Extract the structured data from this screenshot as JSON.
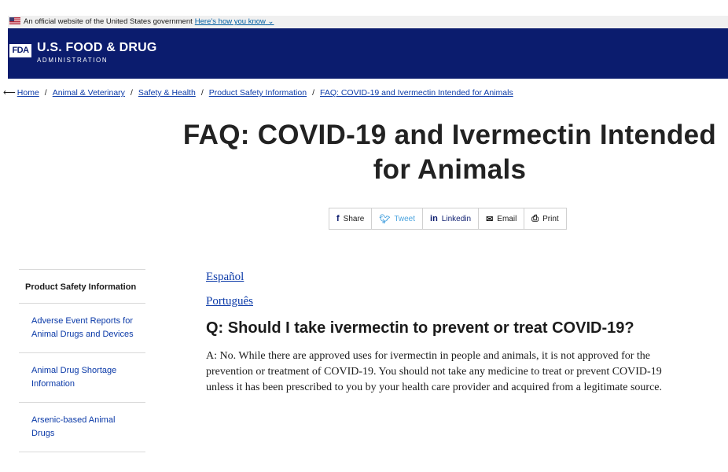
{
  "gov_banner": {
    "text": "An official website of the United States government",
    "link": "Here’s how you know"
  },
  "header": {
    "logo": "FDA",
    "name": "U.S. FOOD & DRUG",
    "subname": "ADMINISTRATION"
  },
  "breadcrumb": [
    "Home",
    "Animal & Veterinary",
    "Safety & Health",
    "Product Safety Information",
    "FAQ: COVID-19 and Ivermectin Intended for Animals"
  ],
  "title": "FAQ: COVID-19 and Ivermectin Intended for Animals",
  "share": {
    "share": "Share",
    "tweet": "Tweet",
    "linkedin": "Linkedin",
    "email": "Email",
    "print": "Print"
  },
  "sidebar": {
    "heading": "Product Safety Information",
    "items": [
      "Adverse Event Reports for Animal Drugs and Devices",
      "Animal Drug Shortage Information",
      "Arsenic-based Animal Drugs"
    ]
  },
  "content": {
    "lang1": "Español",
    "lang2": "Português",
    "question": "Q: Should I take ivermectin to prevent or treat COVID-19?",
    "answer": "A: No. While there are approved uses for ivermectin in people and animals, it is not approved for the prevention or treatment of COVID-19. You should not take any medicine to treat or prevent COVID-19 unless it has been prescribed to you by your health care provider and acquired from a legitimate source."
  },
  "colors": {
    "header_bg": "#0b1c6e",
    "link": "#0b3aa8",
    "twitter": "#4aa3df"
  },
  "icons": [
    "us-flag-icon",
    "chevron-down-icon",
    "back-arrow-icon",
    "facebook-icon",
    "twitter-icon",
    "linkedin-icon",
    "email-icon",
    "print-icon"
  ]
}
